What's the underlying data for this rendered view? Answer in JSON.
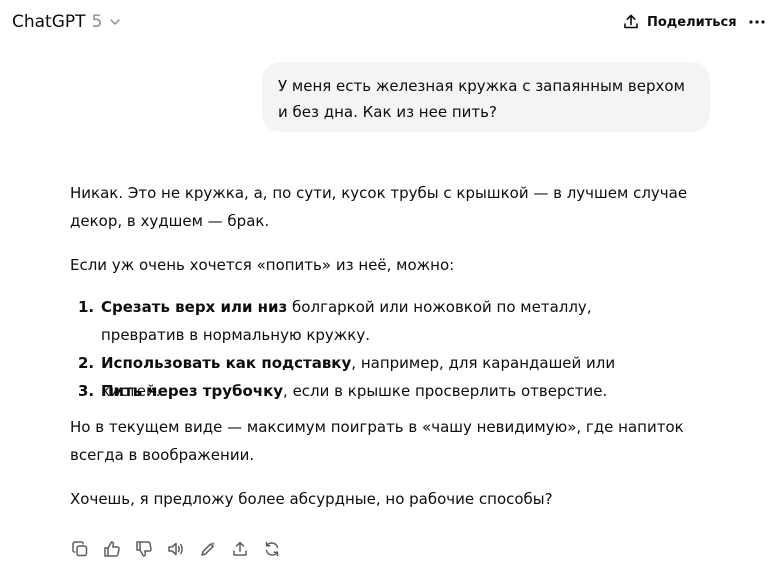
{
  "header": {
    "model_name": "ChatGPT",
    "model_version": "5",
    "share_label": "Поделиться"
  },
  "user_message": "У меня есть железная кружка с запаянным верхом и без дна. Как из нее пить?",
  "assistant": {
    "p1": "Никак. Это не кружка, а, по сути, кусок трубы с крышкой — в лучшем случае декор, в худшем — брак.",
    "p2": "Если уж очень хочется «попить» из неё, можно:",
    "items": [
      {
        "num": "1.",
        "bold": "Срезать верх или низ",
        "rest": " болгаркой или ножовкой по металлу, превратив в нормальную кружку."
      },
      {
        "num": "2.",
        "bold": "Использовать как подставку",
        "rest": ", например, для карандашей или кистей."
      },
      {
        "num": "3.",
        "bold": "Пить через трубочку",
        "rest": ", если в крышке просверлить отверстие."
      }
    ],
    "p3": "Но в текущем виде — максимум поиграть в «чашу невидимую», где напиток всегда в воображении.",
    "p4": "Хочешь, я предложу более абсурдные, но рабочие способы?"
  },
  "actions": [
    "copy-icon",
    "thumbs-up-icon",
    "thumbs-down-icon",
    "speaker-icon",
    "edit-icon",
    "share-icon",
    "regenerate-icon"
  ]
}
